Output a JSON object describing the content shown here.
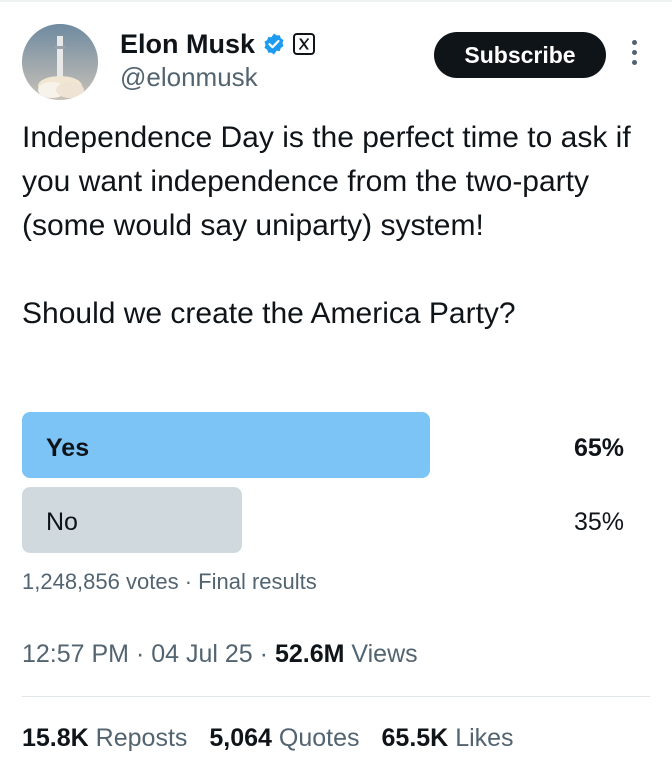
{
  "author": {
    "display_name": "Elon Musk",
    "handle": "@elonmusk",
    "verified_icon": "verified-badge-icon",
    "affiliation_icon": "x-logo-icon"
  },
  "header": {
    "subscribe_label": "Subscribe",
    "more_icon": "more-vertical-icon"
  },
  "tweet": {
    "text": "Independence Day is the perfect time to ask if you want independence from the two-party (some would say uniparty) system!\n\nShould we create the America Party?"
  },
  "poll": {
    "options": [
      {
        "label": "Yes",
        "percent": "65%",
        "share": 0.65,
        "winner": true
      },
      {
        "label": "No",
        "percent": "35%",
        "share": 0.35,
        "winner": false
      }
    ],
    "votes": "1,248,856 votes",
    "separator": "·",
    "status": "Final results"
  },
  "meta": {
    "time": "12:57 PM",
    "date": "04 Jul 25",
    "separator": "·",
    "views_count": "52.6M",
    "views_label": "Views"
  },
  "stats": {
    "reposts_count": "15.8K",
    "reposts_label": "Reposts",
    "quotes_count": "5,064",
    "quotes_label": "Quotes",
    "likes_count": "65.5K",
    "likes_label": "Likes"
  },
  "colors": {
    "winner_bar": "#7cc3f6",
    "loser_bar": "#cfd9de",
    "secondary_text": "#536471",
    "verified_blue": "#1d9bf0"
  }
}
